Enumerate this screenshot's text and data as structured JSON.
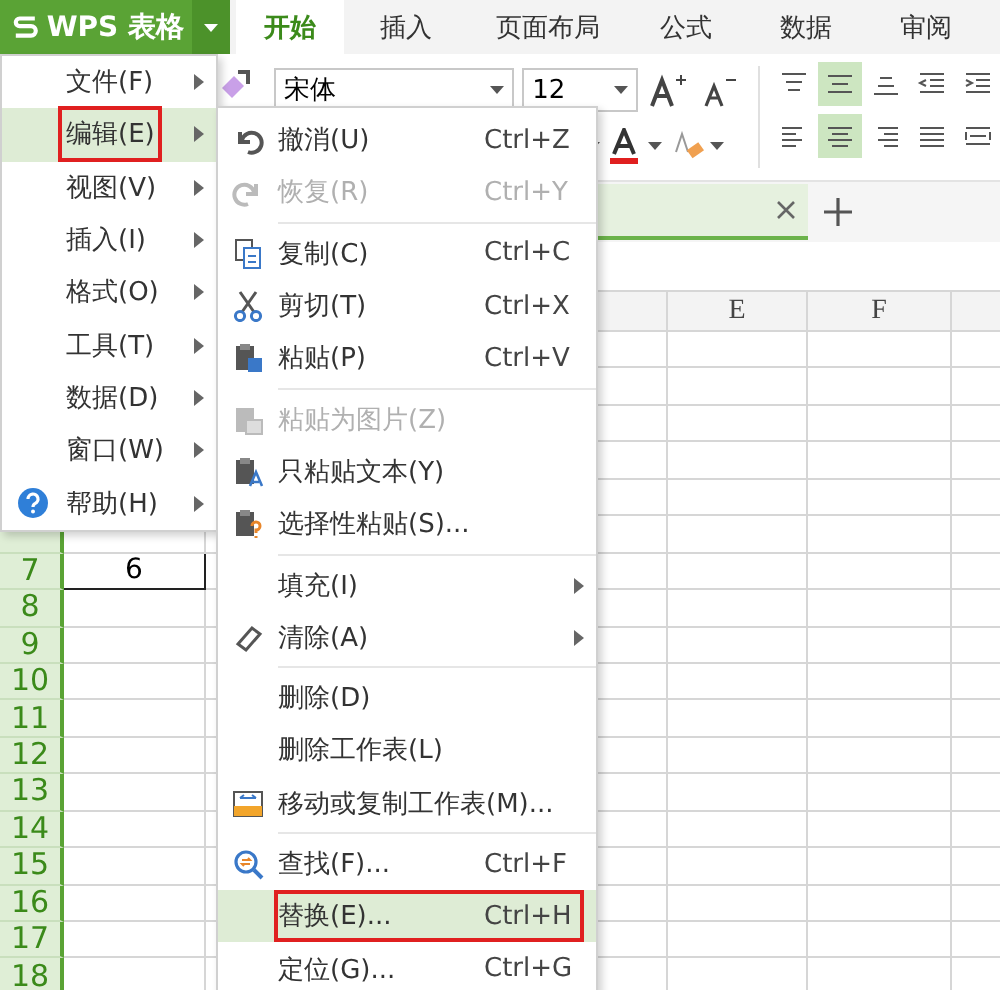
{
  "app_button": {
    "label": "WPS 表格"
  },
  "ribbon_tabs": [
    {
      "label": "开始",
      "selected": true
    },
    {
      "label": "插入",
      "selected": false
    },
    {
      "label": "页面布局",
      "selected": false
    },
    {
      "label": "公式",
      "selected": false
    },
    {
      "label": "数据",
      "selected": false
    },
    {
      "label": "审阅",
      "selected": false
    }
  ],
  "ribbon": {
    "font_name": "宋体",
    "font_size": "12",
    "vertical_align": [
      {
        "selected": false
      },
      {
        "selected": true
      },
      {
        "selected": false
      }
    ],
    "horizontal_align": [
      {
        "selected": false
      },
      {
        "selected": true
      },
      {
        "selected": false
      },
      {
        "selected": false
      }
    ]
  },
  "sheet": {
    "columns": [
      {
        "label": "E"
      },
      {
        "label": "F"
      }
    ],
    "rows": [
      {
        "number": "7",
        "cells": [
          "6"
        ]
      },
      {
        "number": "8",
        "cells": []
      },
      {
        "number": "9",
        "cells": []
      },
      {
        "number": "10",
        "cells": []
      },
      {
        "number": "11",
        "cells": []
      },
      {
        "number": "12",
        "cells": []
      },
      {
        "number": "13",
        "cells": []
      },
      {
        "number": "14",
        "cells": []
      },
      {
        "number": "15",
        "cells": []
      },
      {
        "number": "16",
        "cells": []
      },
      {
        "number": "17",
        "cells": []
      },
      {
        "number": "18",
        "cells": []
      }
    ]
  },
  "main_menu": {
    "items": [
      {
        "label": "文件(F)",
        "has_submenu": true,
        "selected": false,
        "annotated": false
      },
      {
        "label": "编辑(E)",
        "has_submenu": true,
        "selected": true,
        "annotated": true
      },
      {
        "label": "视图(V)",
        "has_submenu": true,
        "selected": false,
        "annotated": false
      },
      {
        "label": "插入(I)",
        "has_submenu": true,
        "selected": false,
        "annotated": false
      },
      {
        "label": "格式(O)",
        "has_submenu": true,
        "selected": false,
        "annotated": false
      },
      {
        "label": "工具(T)",
        "has_submenu": true,
        "selected": false,
        "annotated": false
      },
      {
        "label": "数据(D)",
        "has_submenu": true,
        "selected": false,
        "annotated": false
      },
      {
        "label": "窗口(W)",
        "has_submenu": true,
        "selected": false,
        "annotated": false
      },
      {
        "label": "帮助(H)",
        "has_submenu": true,
        "selected": false,
        "annotated": false
      }
    ]
  },
  "edit_menu": {
    "items": [
      {
        "kind": "item",
        "label": "撤消(U)",
        "shortcut": "Ctrl+Z",
        "disabled": false,
        "selected": false,
        "annotated": false
      },
      {
        "kind": "item",
        "label": "恢复(R)",
        "shortcut": "Ctrl+Y",
        "disabled": true,
        "selected": false,
        "annotated": false
      },
      {
        "kind": "separator"
      },
      {
        "kind": "item",
        "label": "复制(C)",
        "shortcut": "Ctrl+C",
        "disabled": false,
        "selected": false,
        "annotated": false
      },
      {
        "kind": "item",
        "label": "剪切(T)",
        "shortcut": "Ctrl+X",
        "disabled": false,
        "selected": false,
        "annotated": false
      },
      {
        "kind": "item",
        "label": "粘贴(P)",
        "shortcut": "Ctrl+V",
        "disabled": false,
        "selected": false,
        "annotated": false
      },
      {
        "kind": "separator"
      },
      {
        "kind": "item",
        "label": "粘贴为图片(Z)",
        "disabled": true,
        "selected": false,
        "annotated": false
      },
      {
        "kind": "item",
        "label": "只粘贴文本(Y)",
        "disabled": false,
        "selected": false,
        "annotated": false
      },
      {
        "kind": "item",
        "label": "选择性粘贴(S)...",
        "disabled": false,
        "selected": false,
        "annotated": false
      },
      {
        "kind": "separator"
      },
      {
        "kind": "submenu",
        "label": "填充(I)",
        "disabled": false,
        "selected": false,
        "annotated": false
      },
      {
        "kind": "submenu",
        "label": "清除(A)",
        "disabled": false,
        "selected": false,
        "annotated": false
      },
      {
        "kind": "separator"
      },
      {
        "kind": "item",
        "label": "删除(D)",
        "disabled": false,
        "selected": false,
        "annotated": false
      },
      {
        "kind": "item",
        "label": "删除工作表(L)",
        "disabled": false,
        "selected": false,
        "annotated": false
      },
      {
        "kind": "item",
        "label": "移动或复制工作表(M)...",
        "disabled": false,
        "selected": false,
        "annotated": false
      },
      {
        "kind": "separator"
      },
      {
        "kind": "item",
        "label": "查找(F)...",
        "shortcut": "Ctrl+F",
        "disabled": false,
        "selected": false,
        "annotated": false
      },
      {
        "kind": "item",
        "label": "替换(E)...",
        "shortcut": "Ctrl+H",
        "disabled": false,
        "selected": true,
        "annotated": true
      },
      {
        "kind": "item",
        "label": "定位(G)...",
        "shortcut": "Ctrl+G",
        "disabled": false,
        "selected": false,
        "annotated": false
      }
    ]
  }
}
